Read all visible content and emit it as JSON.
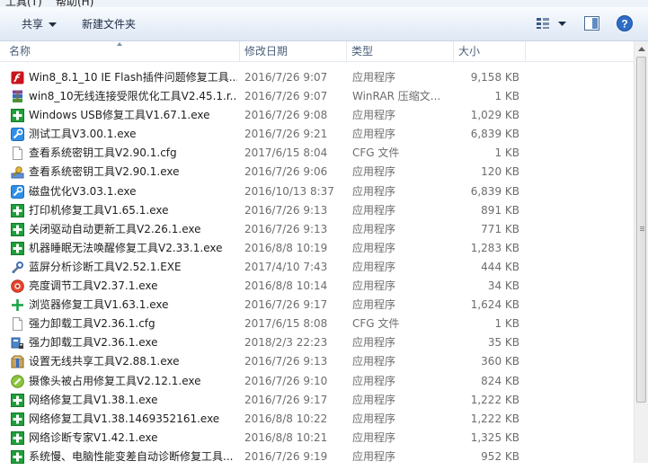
{
  "menubar": {
    "tools": "工具(T)",
    "help": "帮助(H)"
  },
  "toolbar": {
    "share_label": "共享",
    "new_folder_label": "新建文件夹"
  },
  "columns": {
    "name": "名称",
    "date": "修改日期",
    "type": "类型",
    "size": "大小"
  },
  "files": [
    {
      "name": "Win8_8.1_10 IE Flash插件问题修复工具...",
      "date": "2016/7/26 9:07",
      "type": "应用程序",
      "size": "9,158 KB",
      "icon": "flash-app-icon"
    },
    {
      "name": "win8_10无线连接受限优化工具V2.45.1.r...",
      "date": "2016/7/26 9:07",
      "type": "WinRAR 压缩文...",
      "size": "1 KB",
      "icon": "winrar-archive-icon"
    },
    {
      "name": "Windows USB修复工具V1.67.1.exe",
      "date": "2016/7/26 9:08",
      "type": "应用程序",
      "size": "1,029 KB",
      "icon": "green-cross-app-icon"
    },
    {
      "name": "测试工具V3.00.1.exe",
      "date": "2016/7/26 9:21",
      "type": "应用程序",
      "size": "6,839 KB",
      "icon": "blue-wrench-app-icon"
    },
    {
      "name": "查看系统密钥工具V2.90.1.cfg",
      "date": "2017/6/15 8:04",
      "type": "CFG 文件",
      "size": "1 KB",
      "icon": "document-icon"
    },
    {
      "name": "查看系统密钥工具V2.90.1.exe",
      "date": "2016/7/26 9:06",
      "type": "应用程序",
      "size": "120 KB",
      "icon": "key-app-icon"
    },
    {
      "name": "磁盘优化V3.03.1.exe",
      "date": "2016/10/13 8:37",
      "type": "应用程序",
      "size": "6,839 KB",
      "icon": "blue-wrench-app-icon"
    },
    {
      "name": "打印机修复工具V1.65.1.exe",
      "date": "2016/7/26 9:13",
      "type": "应用程序",
      "size": "891 KB",
      "icon": "green-cross-app-icon"
    },
    {
      "name": "关闭驱动自动更新工具V2.26.1.exe",
      "date": "2016/7/26 9:13",
      "type": "应用程序",
      "size": "771 KB",
      "icon": "green-cross-app-icon"
    },
    {
      "name": "机器睡眠无法唤醒修复工具V2.33.1.exe",
      "date": "2016/8/8 10:19",
      "type": "应用程序",
      "size": "1,283 KB",
      "icon": "green-cross-app-icon"
    },
    {
      "name": "蓝屏分析诊断工具V2.52.1.EXE",
      "date": "2017/4/10 7:43",
      "type": "应用程序",
      "size": "444 KB",
      "icon": "wrench-app-icon"
    },
    {
      "name": "亮度调节工具V2.37.1.exe",
      "date": "2016/8/8 10:14",
      "type": "应用程序",
      "size": "34 KB",
      "icon": "red-circle-app-icon"
    },
    {
      "name": "浏览器修复工具V1.63.1.exe",
      "date": "2016/7/26 9:17",
      "type": "应用程序",
      "size": "1,624 KB",
      "icon": "green-plus-app-icon"
    },
    {
      "name": "强力卸载工具V2.36.1.cfg",
      "date": "2017/6/15 8:08",
      "type": "CFG 文件",
      "size": "1 KB",
      "icon": "document-icon"
    },
    {
      "name": "强力卸载工具V2.36.1.exe",
      "date": "2018/2/3 22:23",
      "type": "应用程序",
      "size": "35 KB",
      "icon": "uninstall-app-icon"
    },
    {
      "name": "设置无线共享工具V2.88.1.exe",
      "date": "2016/7/26 9:13",
      "type": "应用程序",
      "size": "360 KB",
      "icon": "package-app-icon"
    },
    {
      "name": "摄像头被占用修复工具V2.12.1.exe",
      "date": "2016/7/26 9:10",
      "type": "应用程序",
      "size": "824 KB",
      "icon": "green-tool-app-icon"
    },
    {
      "name": "网络修复工具V1.38.1.exe",
      "date": "2016/7/26 9:17",
      "type": "应用程序",
      "size": "1,222 KB",
      "icon": "green-cross-app-icon"
    },
    {
      "name": "网络修复工具V1.38.1469352161.exe",
      "date": "2016/8/8 10:22",
      "type": "应用程序",
      "size": "1,222 KB",
      "icon": "green-cross-app-icon"
    },
    {
      "name": "网络诊断专家V1.42.1.exe",
      "date": "2016/8/8 10:21",
      "type": "应用程序",
      "size": "1,325 KB",
      "icon": "green-cross-app-icon"
    },
    {
      "name": "系统慢、电脑性能变差自动诊断修复工具...",
      "date": "2016/7/26 9:19",
      "type": "应用程序",
      "size": "952 KB",
      "icon": "green-cross-app-icon"
    }
  ],
  "colors": {
    "header_text": "#4c607a",
    "meta_text": "#6d6d6d",
    "toolbar_bg": "#e9f0f9",
    "app_icon_green": "#1e9f3a"
  }
}
